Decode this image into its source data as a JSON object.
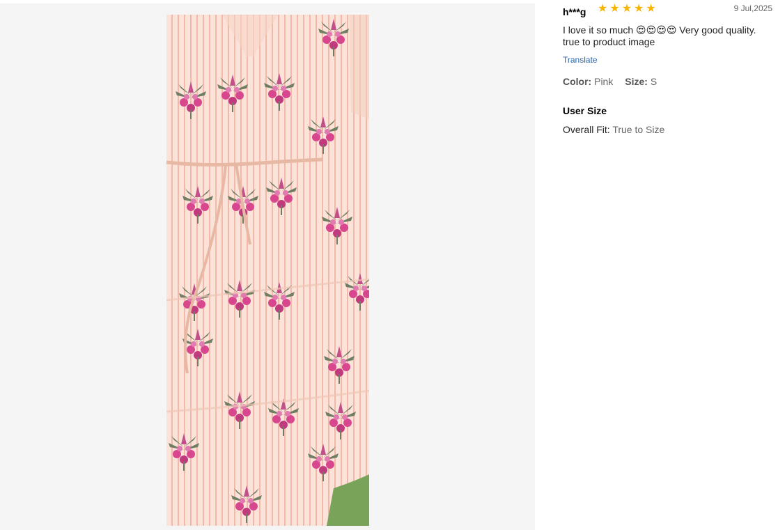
{
  "review": {
    "reviewer": "h***g",
    "rating": 5,
    "date": "9 Jul,2025",
    "text": "I love it so much 😍😍😍😍 Very good quality. true to product image",
    "translate_label": "Translate",
    "color_label": "Color:",
    "color_value": "Pink",
    "size_label": "Size:",
    "size_value": "S",
    "user_size_title": "User Size",
    "fit_label": "Overall Fit:",
    "fit_value": "True to Size"
  },
  "colors": {
    "star": "#f8b400",
    "link": "#2d68a8",
    "panel_bg": "#f5f5f5"
  }
}
